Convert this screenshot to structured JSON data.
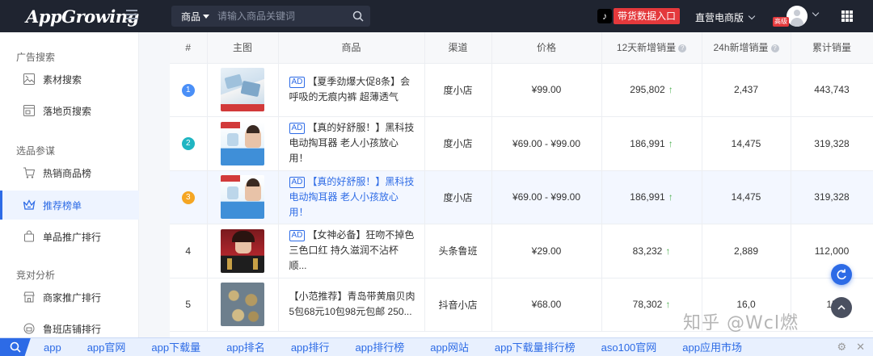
{
  "brand": {
    "name": "AppGrowing"
  },
  "header": {
    "search_type": "商品",
    "search_placeholder": "请输入商品关键词",
    "promo_label": "带货数据入口",
    "edition_label": "直营电商版",
    "vip_label": "高级"
  },
  "sidebar": {
    "sections": [
      {
        "title": "广告搜索",
        "items": [
          {
            "label": "素材搜索"
          },
          {
            "label": "落地页搜索"
          }
        ]
      },
      {
        "title": "选品参谋",
        "items": [
          {
            "label": "热销商品榜"
          },
          {
            "label": "推荐榜单"
          },
          {
            "label": "单品推广排行"
          }
        ]
      },
      {
        "title": "竞对分析",
        "items": [
          {
            "label": "商家推广排行"
          },
          {
            "label": "鲁班店铺排行"
          }
        ]
      }
    ]
  },
  "table": {
    "columns": [
      "#",
      "主图",
      "商品",
      "渠道",
      "价格",
      "12天新增销量",
      "24h新增销量",
      "累计销量"
    ],
    "rows": [
      {
        "rank": "1",
        "ad": "AD",
        "name": "【夏季劲爆大促8条】会呼吸的无痕内裤 超薄透气",
        "channel": "度小店",
        "price": "¥99.00",
        "sales12d": "295,802",
        "sales24h": "2,437",
        "total": "443,743"
      },
      {
        "rank": "2",
        "ad": "AD",
        "name": "【真的好舒服！】黑科技电动掏耳器 老人小孩放心用！",
        "channel": "度小店",
        "price": "¥69.00 - ¥99.00",
        "sales12d": "186,991",
        "sales24h": "14,475",
        "total": "319,328"
      },
      {
        "rank": "3",
        "ad": "AD",
        "name": "【真的好舒服！】黑科技电动掏耳器 老人小孩放心用！",
        "channel": "度小店",
        "price": "¥69.00 - ¥99.00",
        "sales12d": "186,991",
        "sales24h": "14,475",
        "total": "319,328"
      },
      {
        "rank": "4",
        "ad": "AD",
        "name": "【女神必备】狂吻不掉色三色口红 持久滋润不沾杯 顺...",
        "channel": "头条鲁班",
        "price": "¥29.00",
        "sales12d": "83,232",
        "sales24h": "2,889",
        "total": "112,000"
      },
      {
        "rank": "5",
        "ad": "",
        "name": "【小范推荐】青岛带黄扇贝肉5包68元10包98元包邮 250...",
        "channel": "抖音小店",
        "price": "¥68.00",
        "sales12d": "78,302",
        "sales24h": "16,0",
        "total": "15"
      }
    ]
  },
  "watermark": "知乎 @Wcl燃",
  "keywords": [
    "app",
    "app官网",
    "app下载量",
    "app排名",
    "app排行",
    "app排行榜",
    "app网站",
    "app下载量排行榜",
    "aso100官网",
    "app应用市场"
  ],
  "colors": {
    "accent": "#2d6be6",
    "rank1": "#4a8ff7",
    "rank2": "#1fb5c2",
    "rank3": "#f5a623",
    "up": "#4caf50",
    "promo": "#e4393c"
  }
}
